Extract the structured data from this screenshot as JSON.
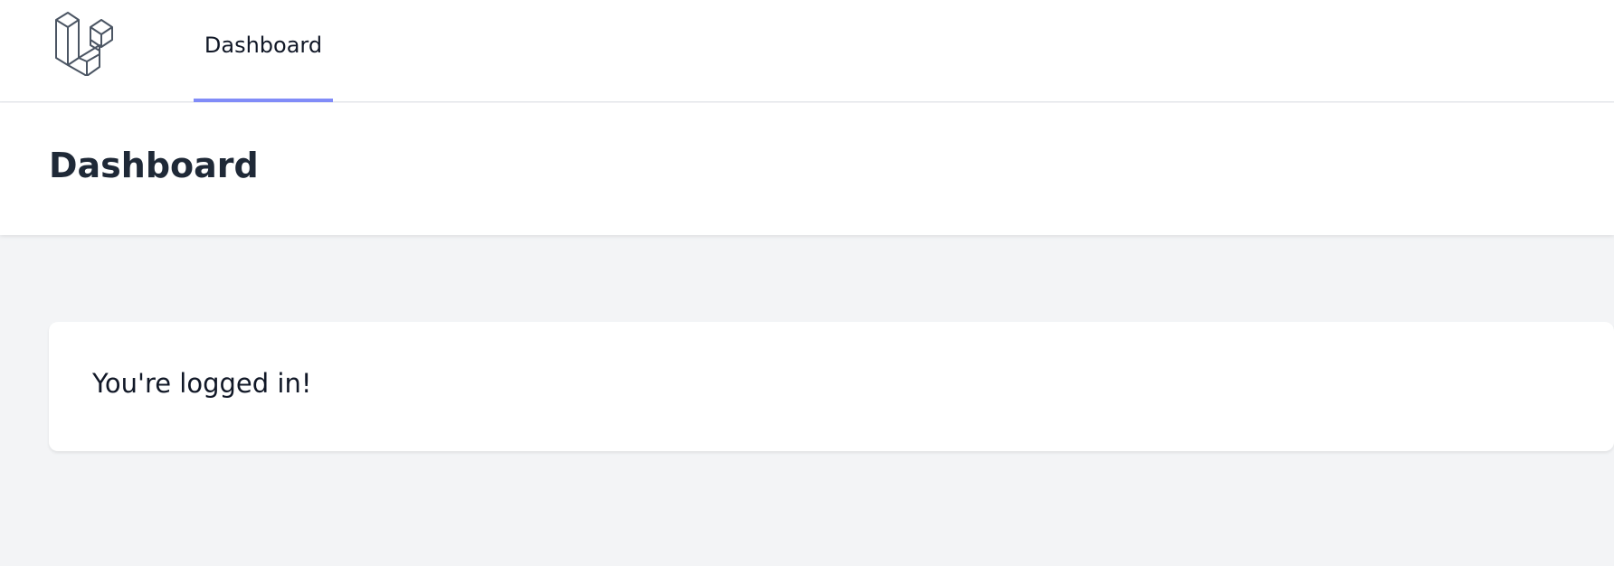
{
  "nav": {
    "logo_icon": "laravel-logo-icon",
    "links": [
      {
        "label": "Dashboard",
        "active": true
      }
    ],
    "active_underline_color": "#818cf8"
  },
  "header": {
    "title": "Dashboard"
  },
  "main": {
    "card": {
      "message": "You're logged in!"
    }
  },
  "colors": {
    "background": "#f3f4f6",
    "surface": "#ffffff",
    "text": "#111827"
  }
}
